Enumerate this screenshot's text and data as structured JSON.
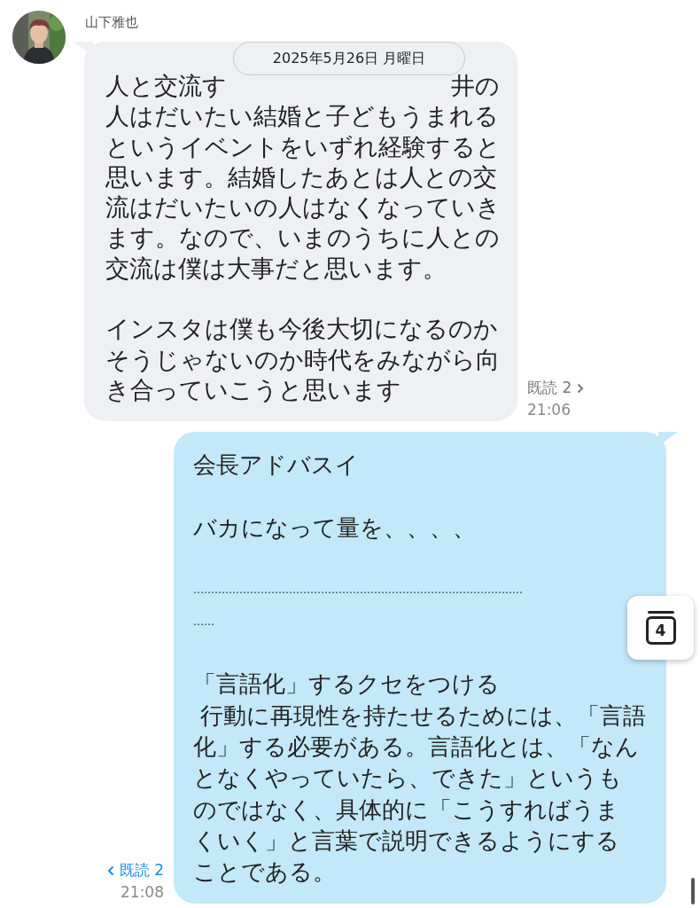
{
  "date_divider": "2025年5月26日 月曜日",
  "messages": [
    {
      "kind": "incoming",
      "sender": "山下雅也",
      "avatar": {
        "kind": "picture"
      },
      "covered_line": [
        "人と交流す",
        "井の"
      ],
      "paragraphs": [
        [
          "人はだいたい結婚と子どもうまれる",
          "というイベントをいずれ経験すると",
          "思います。結婚したあとは人との交",
          "流はだいたいの人はなくなっていき",
          "ます。なので、いまのうちに人との",
          "交流は僕は大事だと思います。"
        ],
        [
          "インスタは僕も今後大切になるのか",
          "そうじゃないのか時代をみながら向",
          "き合っていこうと思います"
        ]
      ],
      "read": "既読 2",
      "time": "21:06"
    },
    {
      "kind": "outgoing",
      "paragraphs": [
        [
          "会長アドバスイ"
        ],
        [
          "バカになって量を、、、、"
        ],
        [
          "…………………………………………………………………………………",
          "……"
        ],
        [
          "「言語化」するクセをつける",
          " 行動に再現性を持たせるためには、「言語",
          "化」する必要がある。言語化とは、「なん",
          "となくやっていたら、できた」というも",
          "のではなく、具体的に「こうすればうま",
          "くいく」と言葉で説明できるようにする",
          "ことである。"
        ]
      ],
      "read": "既読 2",
      "time": "21:08"
    }
  ],
  "floating_button": {
    "label": "4"
  }
}
